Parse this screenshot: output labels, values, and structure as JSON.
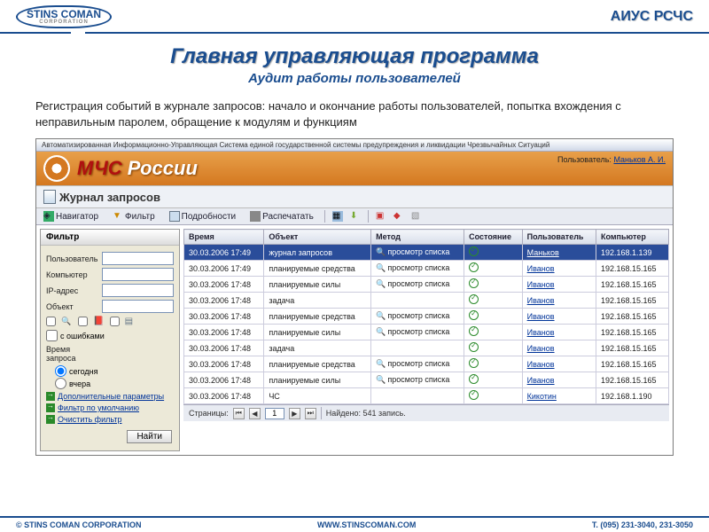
{
  "slide": {
    "logo_top": "STINS COMAN",
    "logo_sub": "CORPORATION",
    "header_right": "АИУС РСЧС",
    "title": "Главная управляющая программа",
    "subtitle": "Аудит работы пользователей",
    "description": "Регистрация событий в журнале запросов: начало и окончание работы пользователей, попытка вхождения с неправильным паролем, обращение к модулям и функциям"
  },
  "app": {
    "sysbar": "Автоматизированная Информационно-Управляющая Система единой государственной системы предупреждения и ликвидации Чрезвычайных Ситуаций",
    "name_red": "МЧС",
    "name_white": " России",
    "user_label": "Пользователь:",
    "user_name": "Маньков А. И.",
    "section_title": "Журнал запросов"
  },
  "toolbar": {
    "navigator": "Навигатор",
    "filter": "Фильтр",
    "details": "Подробности",
    "print": "Распечатать"
  },
  "filter": {
    "panel_title": "Фильтр",
    "user_label": "Пользователь",
    "computer_label": "Компьютер",
    "ip_label": "IP-адрес",
    "object_label": "Объект",
    "with_errors": "с ошибками",
    "time_label": "Время запроса",
    "today": "сегодня",
    "yesterday": "вчера",
    "extra": "Дополнительные параметры",
    "default": "Фильтр по умолчанию",
    "clear": "Очистить фильтр",
    "find": "Найти"
  },
  "grid": {
    "headers": [
      "Время",
      "Объект",
      "Метод",
      "Состояние",
      "Пользователь",
      "Компьютер"
    ],
    "rows": [
      {
        "time": "30.03.2006 17:49",
        "object": "журнал запросов",
        "method": "просмотр списка",
        "user": "Маньков",
        "computer": "192.168.1.139",
        "sel": true
      },
      {
        "time": "30.03.2006 17:49",
        "object": "планируемые средства",
        "method": "просмотр списка",
        "user": "Иванов",
        "computer": "192.168.15.165"
      },
      {
        "time": "30.03.2006 17:48",
        "object": "планируемые силы",
        "method": "просмотр списка",
        "user": "Иванов",
        "computer": "192.168.15.165"
      },
      {
        "time": "30.03.2006 17:48",
        "object": "задача",
        "method": "",
        "user": "Иванов",
        "computer": "192.168.15.165"
      },
      {
        "time": "30.03.2006 17:48",
        "object": "планируемые средства",
        "method": "просмотр списка",
        "user": "Иванов",
        "computer": "192.168.15.165"
      },
      {
        "time": "30.03.2006 17:48",
        "object": "планируемые силы",
        "method": "просмотр списка",
        "user": "Иванов",
        "computer": "192.168.15.165"
      },
      {
        "time": "30.03.2006 17:48",
        "object": "задача",
        "method": "",
        "user": "Иванов",
        "computer": "192.168.15.165"
      },
      {
        "time": "30.03.2006 17:48",
        "object": "планируемые средства",
        "method": "просмотр списка",
        "user": "Иванов",
        "computer": "192.168.15.165"
      },
      {
        "time": "30.03.2006 17:48",
        "object": "планируемые силы",
        "method": "просмотр списка",
        "user": "Иванов",
        "computer": "192.168.15.165"
      },
      {
        "time": "30.03.2006 17:48",
        "object": "ЧС",
        "method": "",
        "user": "Кикотин",
        "computer": "192.168.1.190"
      }
    ]
  },
  "pager": {
    "pages_label": "Страницы:",
    "current": "1",
    "found": "Найдено: 541 запись."
  },
  "footer": {
    "left": "© STINS COMAN CORPORATION",
    "center": "WWW.STINSCOMAN.COM",
    "right": "Т. (095) 231-3040, 231-3050"
  }
}
